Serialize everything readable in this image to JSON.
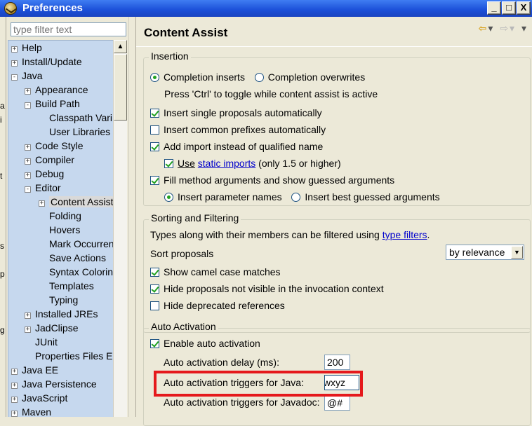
{
  "window": {
    "title": "Preferences",
    "minimize": "_",
    "maximize": "□",
    "close": "X"
  },
  "sidebar": {
    "filter_placeholder": "type filter text",
    "tree": [
      {
        "label": "Help",
        "toggle": "+",
        "depth": 0
      },
      {
        "label": "Install/Update",
        "toggle": "+",
        "depth": 0
      },
      {
        "label": "Java",
        "toggle": "-",
        "depth": 0
      },
      {
        "label": "Appearance",
        "toggle": "+",
        "depth": 1
      },
      {
        "label": "Build Path",
        "toggle": "-",
        "depth": 1
      },
      {
        "label": "Classpath Vari",
        "toggle": "",
        "depth": 2
      },
      {
        "label": "User Libraries",
        "toggle": "",
        "depth": 2
      },
      {
        "label": "Code Style",
        "toggle": "+",
        "depth": 1
      },
      {
        "label": "Compiler",
        "toggle": "+",
        "depth": 1
      },
      {
        "label": "Debug",
        "toggle": "+",
        "depth": 1
      },
      {
        "label": "Editor",
        "toggle": "-",
        "depth": 1
      },
      {
        "label": "Content Assist",
        "toggle": "+",
        "depth": 2,
        "selected": true
      },
      {
        "label": "Folding",
        "toggle": "",
        "depth": 2
      },
      {
        "label": "Hovers",
        "toggle": "",
        "depth": 2
      },
      {
        "label": "Mark Occurren",
        "toggle": "",
        "depth": 2
      },
      {
        "label": "Save Actions",
        "toggle": "",
        "depth": 2
      },
      {
        "label": "Syntax Colorin",
        "toggle": "",
        "depth": 2
      },
      {
        "label": "Templates",
        "toggle": "",
        "depth": 2
      },
      {
        "label": "Typing",
        "toggle": "",
        "depth": 2
      },
      {
        "label": "Installed JREs",
        "toggle": "+",
        "depth": 1
      },
      {
        "label": "JadClipse",
        "toggle": "+",
        "depth": 1
      },
      {
        "label": "JUnit",
        "toggle": "",
        "depth": 1
      },
      {
        "label": "Properties Files E",
        "toggle": "",
        "depth": 1
      },
      {
        "label": "Java EE",
        "toggle": "+",
        "depth": 0
      },
      {
        "label": "Java Persistence",
        "toggle": "+",
        "depth": 0
      },
      {
        "label": "JavaScript",
        "toggle": "+",
        "depth": 0
      },
      {
        "label": "Maven",
        "toggle": "+",
        "depth": 0
      }
    ],
    "edge_glyphs": [
      "a",
      "i",
      "t",
      "s",
      "p",
      "g"
    ]
  },
  "main": {
    "title": "Content Assist",
    "insertion": {
      "legend": "Insertion",
      "completion_inserts": "Completion inserts",
      "completion_overwrites": "Completion overwrites",
      "toggle_hint": "Press 'Ctrl' to toggle while content assist is active",
      "insert_single": "Insert single proposals automatically",
      "insert_prefixes": "Insert common prefixes automatically",
      "add_import": "Add import instead of qualified name",
      "use_prefix": "Use",
      "static_imports_link": "static imports",
      "use_suffix": "(only 1.5 or higher)",
      "fill_method": "Fill method arguments and show guessed arguments",
      "insert_param_names": "Insert parameter names",
      "insert_best_guessed": "Insert best guessed arguments"
    },
    "sorting": {
      "legend": "Sorting and Filtering",
      "types_text": "Types along with their members can be filtered using",
      "type_filters_link": "type filters",
      "period": ".",
      "sort_label": "Sort proposals",
      "sort_value": "by relevance",
      "camel_case": "Show camel case matches",
      "hide_not_visible": "Hide proposals not visible in the invocation context",
      "hide_deprecated": "Hide deprecated references"
    },
    "auto_activation": {
      "legend": "Auto Activation",
      "enable": "Enable auto activation",
      "delay_label": "Auto activation delay (ms):",
      "delay_value": "200",
      "java_label": "Auto activation triggers for Java:",
      "java_value": "/wxyz",
      "javadoc_label": "Auto activation triggers for Javadoc:",
      "javadoc_value": "@#"
    }
  },
  "colors": {
    "titlebar": "#1b4fd8",
    "tree_bg": "#c6d8ee",
    "highlight_box": "#e5191c",
    "link": "#0000cc",
    "check": "#21a121"
  }
}
